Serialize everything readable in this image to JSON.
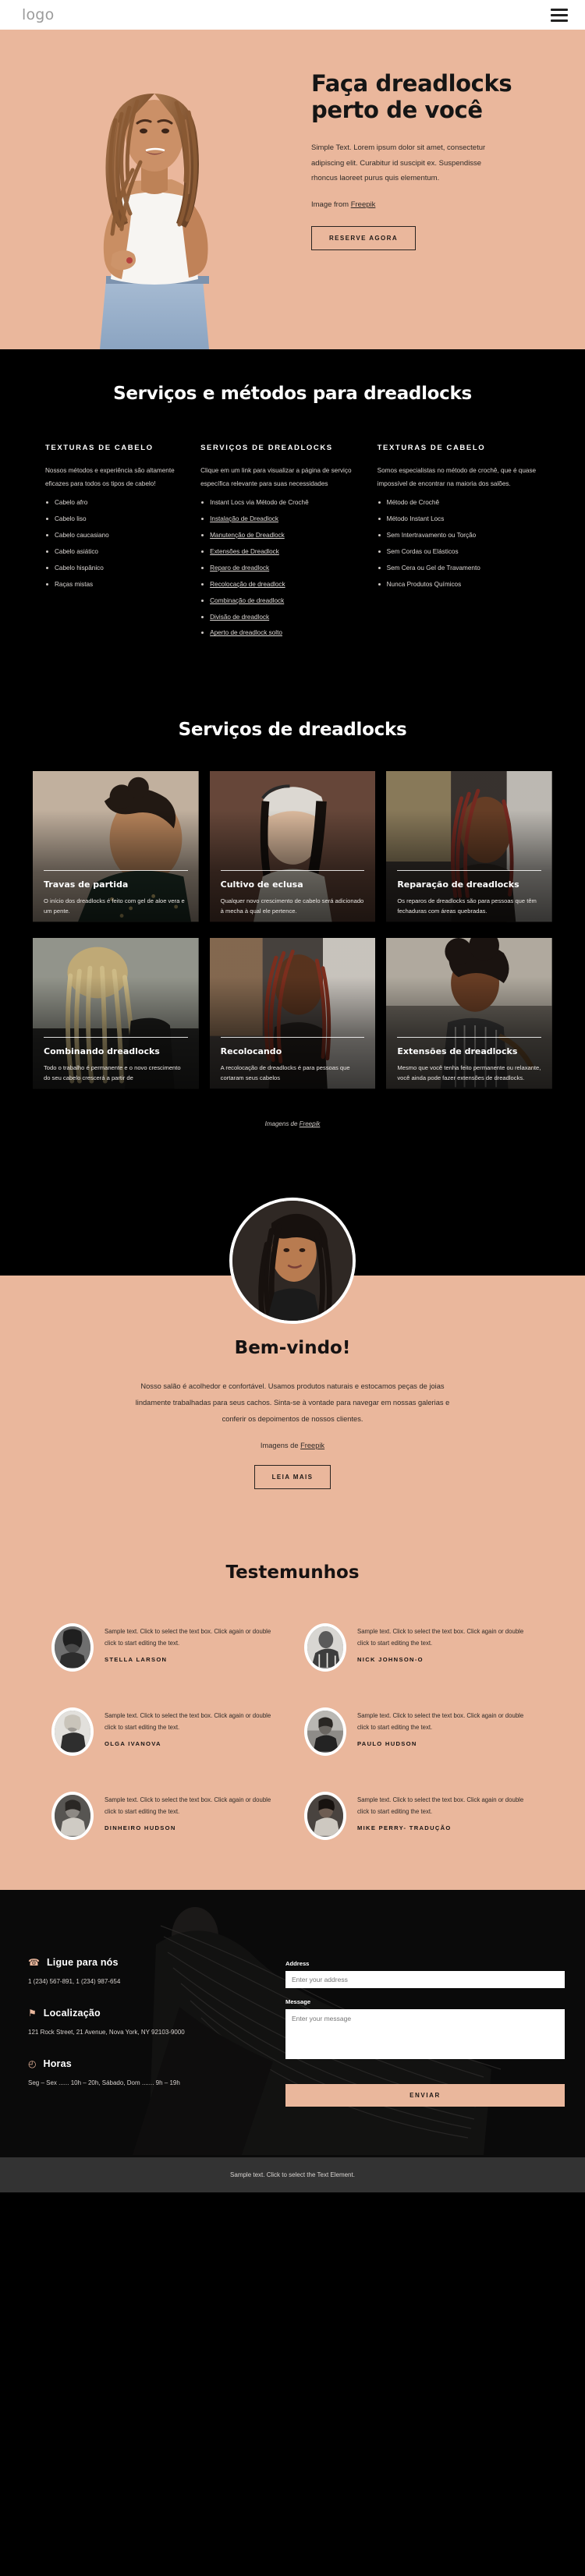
{
  "header": {
    "logo": "logo",
    "menu_icon": "hamburger-menu-icon"
  },
  "hero": {
    "title": "Faça dreadlocks perto de você",
    "body": "Simple Text. Lorem ipsum dolor sit amet, consectetur adipiscing elit. Curabitur id suscipit ex. Suspendisse rhoncus laoreet purus quis elementum.",
    "credit_prefix": "Image from ",
    "credit_link": "Freepik",
    "cta": "RESERVE AGORA",
    "bg_color": "#eab79c"
  },
  "methods": {
    "title": "Serviços e métodos para dreadlocks",
    "columns": [
      {
        "heading": "TEXTURAS DE CABELO",
        "text": "Nossos métodos e experiência são altamente eficazes para todos os tipos de cabelo!",
        "items": [
          {
            "label": "Cabelo afro",
            "link": false
          },
          {
            "label": "Cabelo liso",
            "link": false
          },
          {
            "label": "Cabelo caucasiano",
            "link": false
          },
          {
            "label": "Cabelo asiático",
            "link": false
          },
          {
            "label": "Cabelo hispânico",
            "link": false
          },
          {
            "label": "Raças mistas",
            "link": false
          }
        ]
      },
      {
        "heading": "SERVIÇOS DE DREADLOCKS",
        "text": "Clique em um link para visualizar a página de serviço específica relevante para suas necessidades",
        "items": [
          {
            "label": "Instant Locs via Método de Crochê",
            "link": false
          },
          {
            "label": "Instalação de Dreadlock",
            "link": true
          },
          {
            "label": "Manutenção de Dreadlock",
            "link": true
          },
          {
            "label": "Extensões de Dreadlock",
            "link": true
          },
          {
            "label": "Reparo de dreadlock",
            "link": true
          },
          {
            "label": "Recolocação de dreadlock",
            "link": true
          },
          {
            "label": "Combinação de dreadlock",
            "link": true
          },
          {
            "label": "Divisão de dreadlock",
            "link": true
          },
          {
            "label": "Aperto de dreadlock solto",
            "link": true
          }
        ]
      },
      {
        "heading": "TEXTURAS DE CABELO",
        "text": "Somos especialistas no método de crochê, que é quase impossível de encontrar na maioria dos salões.",
        "items": [
          {
            "label": "Método de Crochê",
            "link": false
          },
          {
            "label": "Método Instant Locs",
            "link": false
          },
          {
            "label": "Sem Intertravamento ou Torção",
            "link": false
          },
          {
            "label": "Sem Cordas ou Elásticos",
            "link": false
          },
          {
            "label": "Sem Cera ou Gel de Travamento",
            "link": false
          },
          {
            "label": "Nunca Produtos Químicos",
            "link": false
          }
        ]
      }
    ]
  },
  "gallery": {
    "title": "Serviços de dreadlocks",
    "credit_prefix": "Imagens de ",
    "credit_link": "Freepik",
    "cards": [
      {
        "title": "Travas de partida",
        "text": "O início dos dreadlocks é feito com gel de aloe vera e um pente."
      },
      {
        "title": "Cultivo de eclusa",
        "text": "Qualquer novo crescimento de cabelo será adicionado à mecha à qual ele pertence."
      },
      {
        "title": "Reparação de dreadlocks",
        "text": "Os reparos de dreadlocks são para pessoas que têm fechaduras com áreas quebradas."
      },
      {
        "title": "Combinando dreadlocks",
        "text": "Todo o trabalho é permanente e o novo crescimento do seu cabelo crescerá a partir de"
      },
      {
        "title": "Recolocando",
        "text": "A recolocação de dreadlocks é para pessoas que cortaram seus cabelos"
      },
      {
        "title": "Extensões de dreadlocks",
        "text": "Mesmo que você tenha feito permanente ou relaxante, você ainda pode fazer extensões de dreadlocks."
      }
    ]
  },
  "welcome": {
    "title": "Bem-vindo!",
    "text": "Nosso salão é acolhedor e confortável. Usamos produtos naturais e estocamos peças de joias lindamente trabalhadas para seus cachos. Sinta-se à vontade para navegar em nossas galerias e conferir os depoimentos de nossos clientes.",
    "credit_prefix": "Imagens de ",
    "credit_link": "Freepik",
    "cta": "LEIA MAIS"
  },
  "testimonials": {
    "title": "Testemunhos",
    "items": [
      {
        "text": "Sample text. Click to select the text box. Click again or double click to start editing the text.",
        "name": "STELLA LARSON"
      },
      {
        "text": "Sample text. Click to select the text box. Click again or double click to start editing the text.",
        "name": "NICK JOHNSON-O"
      },
      {
        "text": "Sample text. Click to select the text box. Click again or double click to start editing the text.",
        "name": "OLGA IVANOVA"
      },
      {
        "text": "Sample text. Click to select the text box. Click again or double click to start editing the text.",
        "name": "PAULO HUDSON"
      },
      {
        "text": "Sample text. Click to select the text box. Click again or double click to start editing the text.",
        "name": "DINHEIRO HUDSON"
      },
      {
        "text": "Sample text. Click to select the text box. Click again or double click to start editing the text.",
        "name": "MIKE PERRY- TRADUÇÃO"
      }
    ]
  },
  "footer": {
    "contact": [
      {
        "icon": "phone-icon",
        "glyph": "☎",
        "heading": "Ligue para nós",
        "text": "1 (234) 567-891, 1 (234) 987-654"
      },
      {
        "icon": "location-pin-icon",
        "glyph": "⚑",
        "heading": "Localização",
        "text": "121 Rock Street, 21 Avenue, Nova York, NY 92103-9000"
      },
      {
        "icon": "clock-icon",
        "glyph": "◴",
        "heading": "Horas",
        "text": "Seg – Sex ...... 10h – 20h, Sábado, Dom ....... 9h – 19h"
      }
    ],
    "form": {
      "address_label": "Address",
      "address_placeholder": "Enter your address",
      "message_label": "Message",
      "message_placeholder": "Enter your message",
      "submit": "ENVIAR"
    },
    "bottom_text": "Sample text. Click to select the Text Element.",
    "accent_color": "#eab79c"
  }
}
